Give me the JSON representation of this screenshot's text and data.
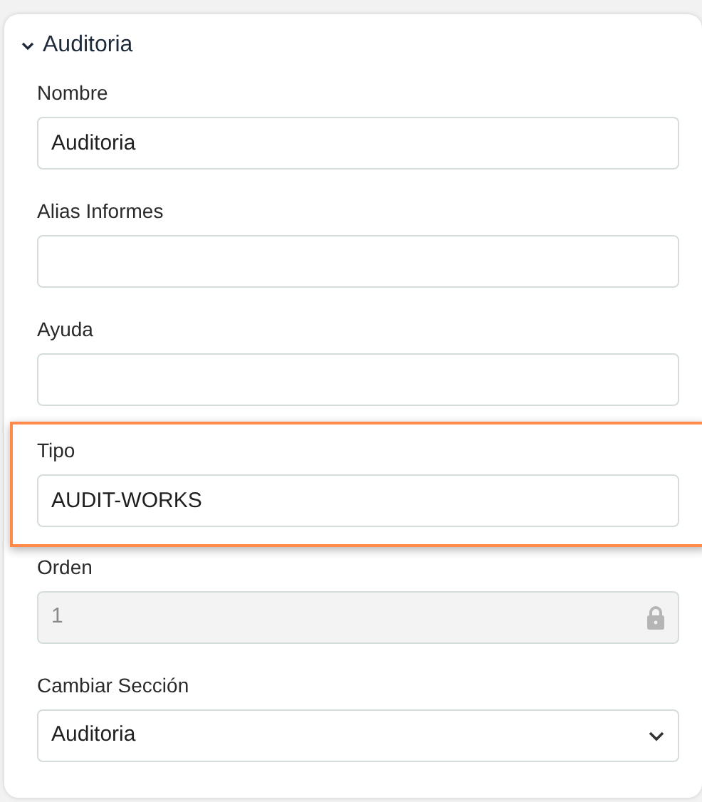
{
  "section": {
    "title": "Auditoria",
    "expanded": true
  },
  "fields": [
    {
      "kind": "text",
      "label": "Nombre",
      "value": "Auditoria",
      "highlighted": false
    },
    {
      "kind": "text",
      "label": "Alias Informes",
      "highlighted": false
    },
    {
      "kind": "text",
      "label": "Ayuda",
      "highlighted": false
    },
    {
      "kind": "text",
      "label": "Tipo",
      "value": "AUDIT-WORKS",
      "highlighted": true
    },
    {
      "kind": "locked",
      "label": "Orden",
      "value": "1",
      "highlighted": false
    },
    {
      "kind": "select",
      "label": "Cambiar Sección",
      "value": "Auditoria",
      "highlighted": false
    }
  ]
}
